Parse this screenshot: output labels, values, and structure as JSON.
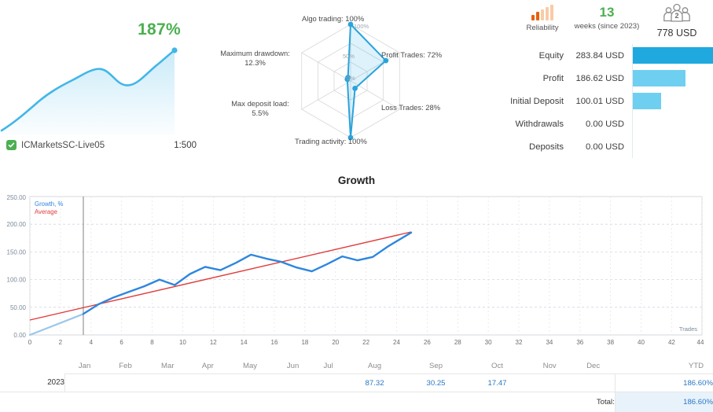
{
  "account": {
    "growth_percent_label": "187%",
    "name": "ICMarketsSC-Live05",
    "leverage": "1:500",
    "verified_icon": "verified-check-icon"
  },
  "radar": {
    "inner_labels": {
      "outer": "100%",
      "middle": "50%",
      "center": "0%"
    },
    "axes": [
      {
        "key": "algo_trading",
        "label": "Algo trading: 100%",
        "value": 100
      },
      {
        "key": "profit_trades",
        "label": "Profit Trades: 72%",
        "value": 72
      },
      {
        "key": "loss_trades",
        "label": "Loss Trades: 28%",
        "value": 28
      },
      {
        "key": "trading_activity",
        "label": "Trading activity: 100%",
        "value": 100
      },
      {
        "key": "max_deposit_load",
        "label": "Max deposit load:",
        "label2": "5.5%",
        "value": 5.5
      },
      {
        "key": "max_drawdown",
        "label": "Maximum drawdown:",
        "label2": "12.3%",
        "value": 12.3
      }
    ]
  },
  "stats": {
    "reliability": {
      "label": "Reliability",
      "filled": 2,
      "total": 5,
      "icon": "signal-bars-icon"
    },
    "weeks": {
      "value": "13",
      "label": "weeks (since 2023)"
    },
    "subscribers": {
      "count": "2",
      "amount": "778 USD",
      "icon": "subscribers-group-icon"
    }
  },
  "equity": {
    "rows": [
      {
        "label": "Equity",
        "value": "283.84 USD",
        "bar_pct": 100,
        "primary": true
      },
      {
        "label": "Profit",
        "value": "186.62 USD",
        "bar_pct": 65.8,
        "primary": false
      },
      {
        "label": "Initial Deposit",
        "value": "100.01 USD",
        "bar_pct": 35.2,
        "primary": false
      },
      {
        "label": "Withdrawals",
        "value": "0.00 USD",
        "bar_pct": 0,
        "primary": false
      },
      {
        "label": "Deposits",
        "value": "0.00 USD",
        "bar_pct": 0,
        "primary": false
      }
    ]
  },
  "chart_data": {
    "type": "line",
    "title": "Growth",
    "xlabel": "Trades",
    "ylabel": "",
    "xlim": [
      0,
      44
    ],
    "ylim": [
      0,
      250
    ],
    "ytick_labels": [
      "0.00",
      "50.00",
      "100.00",
      "150.00",
      "200.00",
      "250.00"
    ],
    "yticks": [
      0,
      50,
      100,
      150,
      200,
      250
    ],
    "xticks": [
      0,
      2,
      4,
      6,
      8,
      10,
      12,
      14,
      16,
      18,
      20,
      22,
      24,
      26,
      28,
      30,
      32,
      34,
      36,
      38,
      40,
      42,
      44
    ],
    "grid": true,
    "legend_position": "top-left",
    "series": [
      {
        "name": "Growth, %",
        "color": "#2E86DE",
        "x": [
          0,
          1,
          2,
          3,
          4,
          5,
          6,
          7,
          8,
          9,
          10,
          11,
          12,
          13,
          14,
          15,
          16,
          17,
          18,
          19,
          20,
          21,
          22,
          23,
          24,
          25
        ],
        "values": [
          0,
          10,
          21,
          31,
          38,
          55,
          68,
          78,
          88,
          100,
          93,
          110,
          123,
          117,
          130,
          145,
          138,
          132,
          122,
          115,
          128,
          142,
          135,
          141,
          160,
          185
        ]
      },
      {
        "name": "Average",
        "color": "#E03B3B",
        "x": [
          0,
          25
        ],
        "values": [
          27,
          186
        ]
      }
    ]
  },
  "months_table": {
    "columns": [
      "",
      "Jan",
      "Feb",
      "Mar",
      "Apr",
      "May",
      "Jun",
      "Jul",
      "Aug",
      "Sep",
      "Oct",
      "Nov",
      "Dec",
      "YTD"
    ],
    "rows": [
      {
        "year": "2023",
        "values": [
          "",
          "",
          "",
          "",
          "",
          "",
          "",
          "87.32",
          "30.25",
          "17.47",
          "",
          ""
        ],
        "ytd": "186.60%"
      }
    ],
    "total_label": "Total:",
    "total_value": "186.60%"
  }
}
